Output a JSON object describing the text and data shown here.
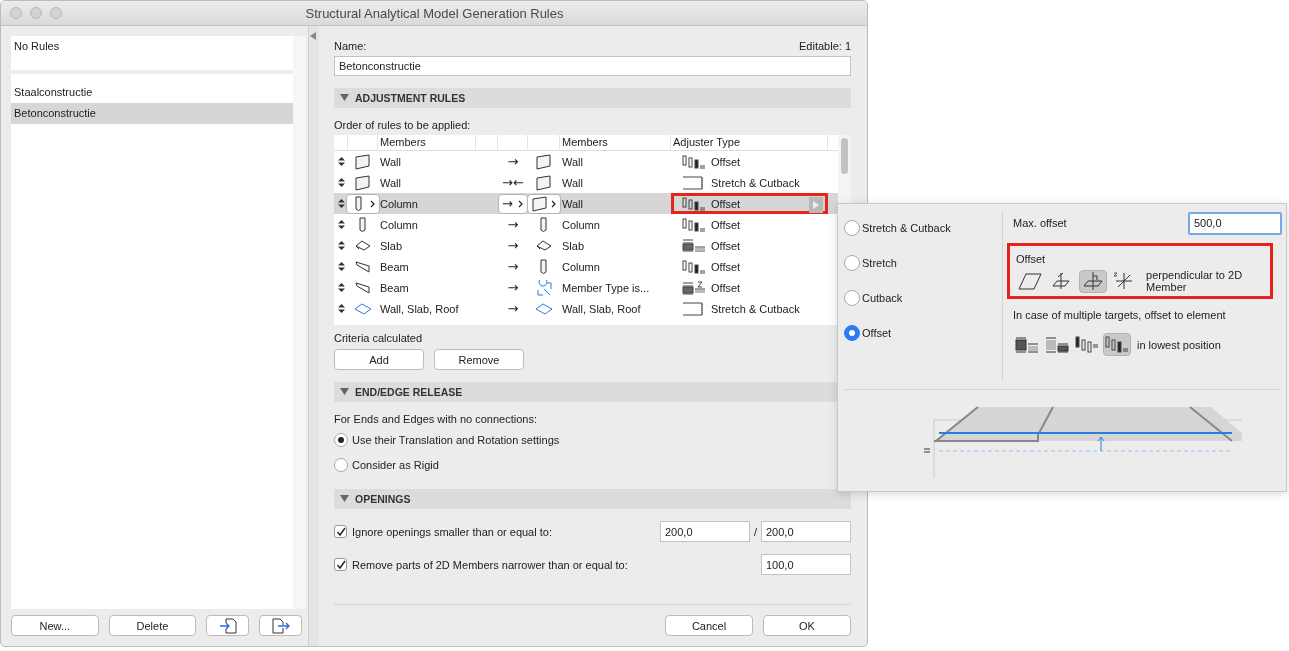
{
  "window": {
    "title": "Structural Analytical Model Generation Rules"
  },
  "rule_list": [
    {
      "label": "No Rules",
      "selected": false,
      "kind": "default"
    },
    {
      "label": "Staalconstructie",
      "selected": false,
      "kind": "rule"
    },
    {
      "label": "Betonconstructie",
      "selected": true,
      "kind": "rule"
    }
  ],
  "sidebar_buttons": [
    {
      "kind": "text",
      "label": "New..."
    },
    {
      "kind": "text",
      "label": "Delete"
    },
    {
      "kind": "import"
    },
    {
      "kind": "export"
    }
  ],
  "name": {
    "label": "Name:",
    "value": "Betonconstructie",
    "editable": "Editable: 1"
  },
  "adjustment_rules": {
    "header": "ADJUSTMENT RULES",
    "expanded": true,
    "order_label": "Order of rules to be applied:",
    "columns": [
      "Members",
      "Members",
      "Adjuster Type"
    ],
    "rows": [
      {
        "source": {
          "kind": "wall",
          "label": "Wall"
        },
        "connector": "→",
        "target": {
          "kind": "wall",
          "label": "Wall"
        },
        "adjuster": {
          "kind": "column-offset",
          "label": "Offset"
        },
        "selected": false,
        "highlighted": false
      },
      {
        "source": {
          "kind": "wall",
          "label": "Wall"
        },
        "connector": "→←",
        "target": {
          "kind": "wall",
          "label": "Wall"
        },
        "adjuster": {
          "kind": "stretch-cutback",
          "label": "Stretch & Cutback"
        },
        "selected": false,
        "highlighted": false
      },
      {
        "source": {
          "kind": "column",
          "label": "Column"
        },
        "connector": "→",
        "target": {
          "kind": "wall",
          "label": "Wall"
        },
        "adjuster": {
          "kind": "column-offset",
          "label": "Offset"
        },
        "selected": true,
        "highlighted": true
      },
      {
        "source": {
          "kind": "column",
          "label": "Column"
        },
        "connector": "→",
        "target": {
          "kind": "column",
          "label": "Column"
        },
        "adjuster": {
          "kind": "column-offset",
          "label": "Offset"
        },
        "selected": false,
        "highlighted": false
      },
      {
        "source": {
          "kind": "slab",
          "label": "Slab"
        },
        "connector": "→",
        "target": {
          "kind": "slab",
          "label": "Slab"
        },
        "adjuster": {
          "kind": "slab-offset",
          "label": "Offset"
        },
        "selected": false,
        "highlighted": false
      },
      {
        "source": {
          "kind": "beam",
          "label": "Beam"
        },
        "connector": "→",
        "target": {
          "kind": "column",
          "label": "Column"
        },
        "adjuster": {
          "kind": "column-offset",
          "label": "Offset"
        },
        "selected": false,
        "highlighted": false
      },
      {
        "source": {
          "kind": "beam",
          "label": "Beam"
        },
        "connector": "→",
        "target": {
          "kind": "member-type",
          "label": "Member Type is..."
        },
        "adjuster": {
          "kind": "slab-z-offset",
          "label": "Offset"
        },
        "selected": false,
        "highlighted": false
      },
      {
        "source": {
          "kind": "multi",
          "label": "Wall, Slab, Roof"
        },
        "connector": "→",
        "target": {
          "kind": "multi",
          "label": "Wall, Slab, Roof"
        },
        "adjuster": {
          "kind": "stretch-cutback",
          "label": "Stretch & Cutback"
        },
        "selected": false,
        "highlighted": false
      }
    ],
    "criteria": "Criteria calculated",
    "buttons": [
      "Add",
      "Remove"
    ]
  },
  "end_release": {
    "header": "END/EDGE RELEASE",
    "expanded": true,
    "prompt": "For Ends and Edges with no connections:",
    "options": [
      {
        "label": "Use their Translation and Rotation settings",
        "selected": true
      },
      {
        "label": "Consider as Rigid",
        "selected": false
      }
    ]
  },
  "openings": {
    "header": "OPENINGS",
    "expanded": true,
    "rows": [
      {
        "label": "Ignore openings smaller than or equal to:",
        "checked": true,
        "values": [
          "200,0",
          "200,0"
        ],
        "separator": "/"
      },
      {
        "label": "Remove parts of 2D Members narrower than or equal to:",
        "checked": true,
        "values": [
          "100,0"
        ]
      }
    ]
  },
  "footer_buttons": [
    "Cancel",
    "OK"
  ],
  "adjuster_popup": {
    "types": [
      {
        "label": "Stretch & Cutback",
        "selected": false
      },
      {
        "label": "Stretch",
        "selected": false
      },
      {
        "label": "Cutback",
        "selected": false
      },
      {
        "label": "Offset",
        "selected": true
      }
    ],
    "max_offset": {
      "label": "Max. offset",
      "value": "500,0"
    },
    "offset": {
      "label": "Offset",
      "highlighted": true,
      "directions": [
        {
          "kind": "plane",
          "selected": false
        },
        {
          "kind": "vertical",
          "selected": false
        },
        {
          "kind": "perpendicular",
          "selected": true
        },
        {
          "kind": "xyz",
          "selected": false
        }
      ],
      "direction_label": "perpendicular to 2D Member"
    },
    "targets_label": "In case of multiple targets, offset to element",
    "positions": [
      {
        "kind": "slab-top",
        "selected": false
      },
      {
        "kind": "slab-bottom",
        "selected": false
      },
      {
        "kind": "column-top",
        "selected": false
      },
      {
        "kind": "column-bottom",
        "selected": true
      }
    ],
    "position_label": "in lowest position"
  }
}
